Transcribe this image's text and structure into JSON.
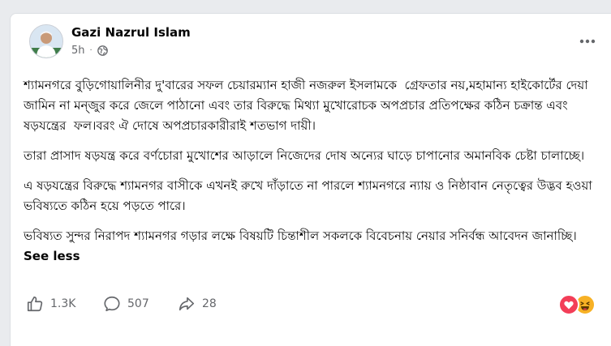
{
  "post": {
    "author": "Gazi Nazrul Islam",
    "time": "5h",
    "paragraphs": [
      "শ্যামনগরে বুড়িগোয়ালিনীর দু'বারের সফল চেয়ারম্যান হাজী নজরুল ইসলামকে  গ্রেফতার নয়,মহামান্য হাইকোর্টের দেয়া জামিন না মন্জুর করে জেলে পাঠানো এবং তার বিরুদ্ধে মিথ্যা মুখোরোচক অপপ্রচার প্রতিপক্ষের কঠিন চক্রান্ত এবং ষড়যন্ত্রের  ফল।বরং ঐ দোষে অপপ্রচারকারীরাই শতভাগ দায়ী।",
      "তারা প্রাসাদ ষড়যন্ত্র করে বর্ণচোরা মুখোশের আড়ালে নিজেদের দোষ অন্যের ঘাড়ে চাপানোর অমানবিক চেষ্টা চালাচ্ছে।",
      "এ ষড়যন্ত্রের বিরুদ্ধে শ্যামনগর বাসীকে এখনই রুখে দাঁড়াতে না পারলে শ্যামনগরে ন্যায় ও নিষ্ঠাবান নেতৃত্বের উদ্ভব হওয়া ভবিষ্যতে কঠিন হয়ে পড়তে পারে।",
      "ভবিষ্যত সুন্দর নিরাপদ শ্যামনগর গড়ার লক্ষে বিষয়টি চিন্তাশীল সকলকে বিবেচনায় নেয়ার সনির্বন্ধ আবেদন জানাচ্ছি।"
    ],
    "see_less": "See less"
  },
  "actions": {
    "likes": "1.3K",
    "comments": "507",
    "shares": "28"
  },
  "icons": {
    "privacy": "globe-icon",
    "more": "more-horizontal-icon",
    "like": "thumbs-up-icon",
    "comment": "comment-bubble-icon",
    "share": "share-arrow-icon"
  },
  "colors": {
    "text": "#050505",
    "secondary": "#65676b",
    "like_blue": "#1877f2",
    "love_red": "#f33e58",
    "haha_yellow": "#f7b125"
  }
}
